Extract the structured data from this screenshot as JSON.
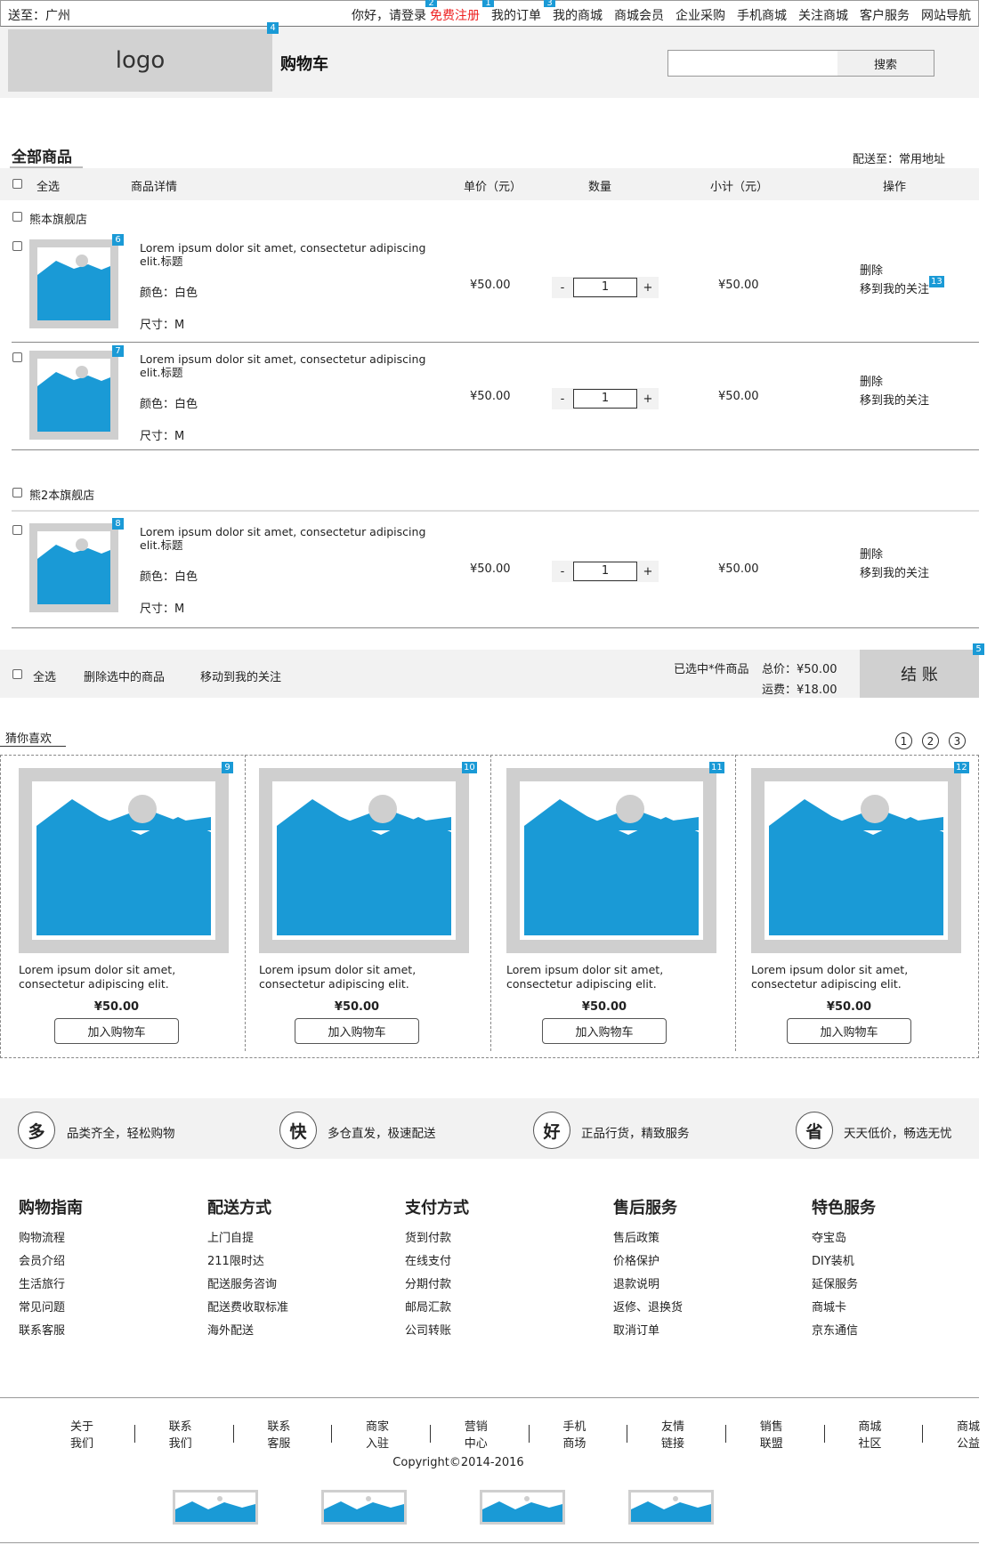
{
  "topbar": {
    "location": "送至：广州",
    "greeting": "你好，请登录",
    "register": "免费注册",
    "links": [
      "我的订单",
      "我的商城",
      "商城会员",
      "企业采购",
      "手机商城",
      "关注商城",
      "客户服务",
      "网站导航"
    ]
  },
  "header": {
    "logo": "logo",
    "title": "购物车",
    "search_button": "搜索",
    "search_value": ""
  },
  "cart": {
    "section_title": "全部商品",
    "ship_to": "配送至：常用地址",
    "columns": {
      "select_all": "全选",
      "detail": "商品详情",
      "unit_price": "单价（元）",
      "quantity": "数量",
      "subtotal": "小计（元）",
      "actions": "操作"
    },
    "shops": [
      {
        "name": "熊本旗舰店",
        "items": [
          {
            "badge": "6",
            "desc": "Lorem ipsum dolor sit amet, consectetur adipiscing elit.标题",
            "color": "颜色：白色",
            "size": "尺寸：M",
            "price": "¥50.00",
            "qty": "1",
            "subtotal": "¥50.00",
            "delete": "删除",
            "follow": "移到我的关注",
            "follow_badge": "13"
          },
          {
            "badge": "7",
            "desc": "Lorem ipsum dolor sit amet, consectetur adipiscing elit.标题",
            "color": "颜色：白色",
            "size": "尺寸：M",
            "price": "¥50.00",
            "qty": "1",
            "subtotal": "¥50.00",
            "delete": "删除",
            "follow": "移到我的关注"
          }
        ]
      },
      {
        "name": "熊2本旗舰店",
        "items": [
          {
            "badge": "8",
            "desc": "Lorem ipsum dolor sit amet, consectetur adipiscing elit.标题",
            "color": "颜色：白色",
            "size": "尺寸：M",
            "price": "¥50.00",
            "qty": "1",
            "subtotal": "¥50.00",
            "delete": "删除",
            "follow": "移到我的关注"
          }
        ]
      }
    ],
    "qty_minus": "-",
    "qty_plus": "+",
    "footer": {
      "select_all": "全选",
      "delete_selected": "删除选中的商品",
      "move_follow": "移动到我的关注",
      "selected_count": "已选中*件商品",
      "total": "总价：¥50.00",
      "shipping": "运费：¥18.00",
      "checkout": "结 账"
    }
  },
  "badges": {
    "header": "4",
    "register": "2",
    "order": "1",
    "mall": "3",
    "checkout": "5"
  },
  "recommend": {
    "title": "猜你喜欢",
    "pages": [
      "1",
      "2",
      "3"
    ],
    "items": [
      {
        "badge": "9",
        "desc": "Lorem ipsum dolor sit amet, consectetur adipiscing elit.",
        "price": "¥50.00",
        "button": "加入购物车"
      },
      {
        "badge": "10",
        "desc": "Lorem ipsum dolor sit amet, consectetur adipiscing elit.",
        "price": "¥50.00",
        "button": "加入购物车"
      },
      {
        "badge": "11",
        "desc": "Lorem ipsum dolor sit amet, consectetur adipiscing elit.",
        "price": "¥50.00",
        "button": "加入购物车"
      },
      {
        "badge": "12",
        "desc": "Lorem ipsum dolor sit amet, consectetur adipiscing elit.",
        "price": "¥50.00",
        "button": "加入购物车"
      }
    ]
  },
  "features": [
    {
      "icon": "多",
      "text": "品类齐全，轻松购物"
    },
    {
      "icon": "快",
      "text": "多仓直发，极速配送"
    },
    {
      "icon": "好",
      "text": "正品行货，精致服务"
    },
    {
      "icon": "省",
      "text": "天天低价，畅选无忧"
    }
  ],
  "footer_columns": [
    {
      "title": "购物指南",
      "items": [
        "购物流程",
        "会员介绍",
        "生活旅行",
        "常见问题",
        "联系客服"
      ]
    },
    {
      "title": "配送方式",
      "items": [
        "上门自提",
        "211限时达",
        "配送服务咨询",
        "配送费收取标准",
        "海外配送"
      ]
    },
    {
      "title": "支付方式",
      "items": [
        "货到付款",
        "在线支付",
        "分期付款",
        "邮局汇款",
        "公司转账"
      ]
    },
    {
      "title": "售后服务",
      "items": [
        "售后政策",
        "价格保护",
        "退款说明",
        "返修、退换货",
        "取消订单"
      ]
    },
    {
      "title": "特色服务",
      "items": [
        "夺宝岛",
        "DIY装机",
        "延保服务",
        "商城卡",
        "京东通信"
      ]
    }
  ],
  "bottom_links": [
    "关于我们",
    "联系我们",
    "联系客服",
    "商家入驻",
    "营销中心",
    "手机商场",
    "友情链接",
    "销售联盟",
    "商城社区",
    "商城公益"
  ],
  "copyright": "Copyright©2014-2016",
  "colors": {
    "accent": "#1a9ad6",
    "register": "#e22222",
    "gray_bg": "#f2f2f2",
    "placeholder": "#cfcfcf"
  }
}
